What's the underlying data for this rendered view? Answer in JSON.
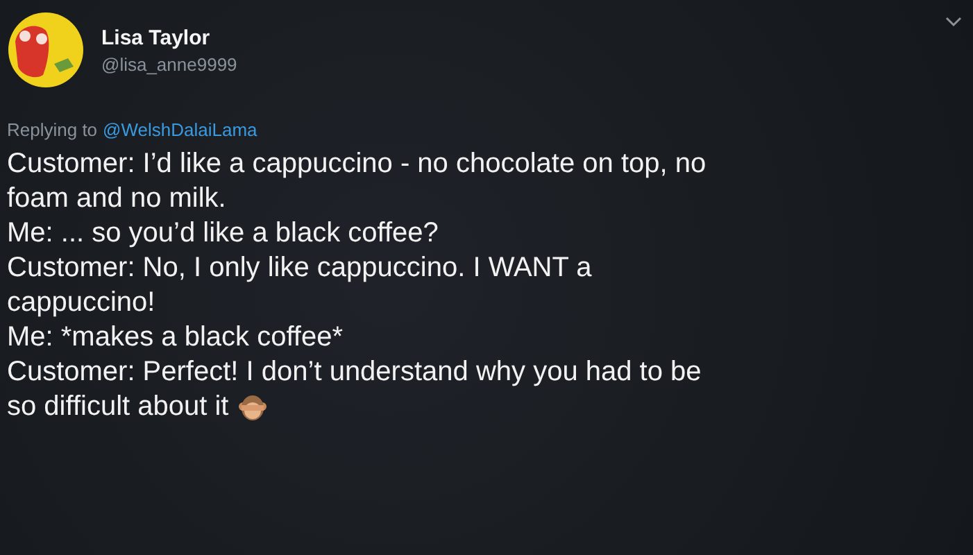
{
  "tweet": {
    "author": {
      "name": "Lisa Taylor",
      "handle": "@lisa_anne9999"
    },
    "reply_prefix": "Replying to",
    "reply_to": "@WelshDalaiLama",
    "lines": [
      "Customer: I’d like a cappuccino - no chocolate on top, no",
      "foam and no milk.",
      "Me: ... so you’d like a black coffee?",
      "Customer: No, I only like cappuccino. I WANT a",
      "cappuccino!",
      "Me: *makes a black coffee*",
      "Customer: Perfect! I don’t understand why you had to be",
      "so difficult about it"
    ]
  }
}
